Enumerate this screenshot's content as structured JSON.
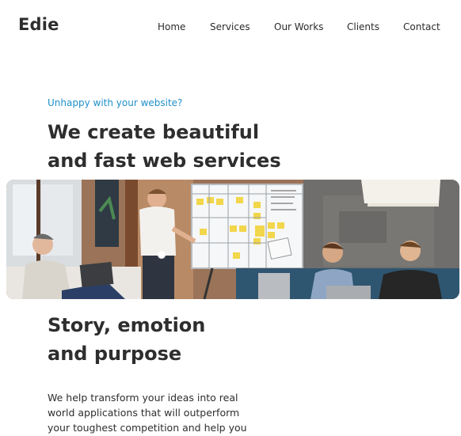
{
  "header": {
    "brand": "Edie",
    "nav": [
      "Home",
      "Services",
      "Our Works",
      "Clients",
      "Contact"
    ]
  },
  "hero": {
    "eyebrow": "Unhappy with your website?",
    "headline_line1": "We create beautiful",
    "headline_line2": "and fast web services",
    "image_alt": "Team meeting in an office with a presenter at a whiteboard"
  },
  "section": {
    "title_line1": "Story, emotion",
    "title_line2": "and purpose",
    "body_line1": "We help transform your ideas into real",
    "body_line2": "world applications that will outperform",
    "body_line3": "your toughest competition and help you"
  },
  "colors": {
    "accent": "#1f8fc8",
    "text": "#2e2e2e"
  }
}
